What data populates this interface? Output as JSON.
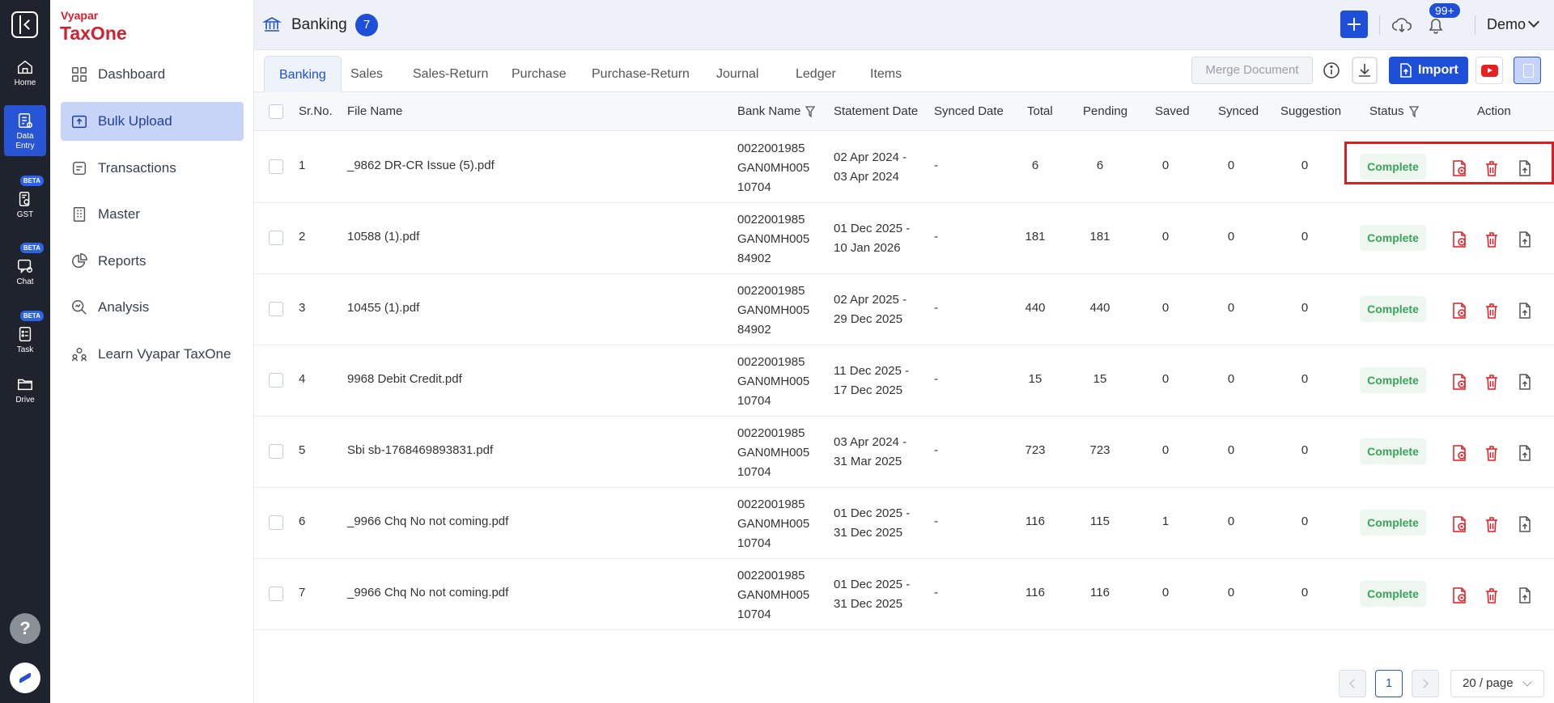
{
  "rail": {
    "items": [
      {
        "label": "Home"
      },
      {
        "label": "Data\nEntry"
      },
      {
        "label": "GST"
      },
      {
        "label": "Chat"
      },
      {
        "label": "Task"
      },
      {
        "label": "Drive"
      }
    ],
    "beta": "BETA",
    "help": "?"
  },
  "brand": {
    "top": "Vyapar",
    "main": "TaxOne"
  },
  "sidebar": {
    "items": [
      {
        "label": "Dashboard",
        "icon": "grid-icon"
      },
      {
        "label": "Bulk Upload",
        "icon": "upload-icon"
      },
      {
        "label": "Transactions",
        "icon": "transactions-icon"
      },
      {
        "label": "Master",
        "icon": "building-icon"
      },
      {
        "label": "Reports",
        "icon": "pie-chart-icon"
      },
      {
        "label": "Analysis",
        "icon": "magnifier-icon"
      },
      {
        "label": "Learn Vyapar TaxOne",
        "icon": "users-icon"
      }
    ]
  },
  "header": {
    "title": "Banking",
    "count": "7",
    "notifications": "99+",
    "user": "Demo"
  },
  "tabs": [
    "Banking",
    "Sales",
    "Sales-Return",
    "Purchase",
    "Purchase-Return",
    "Journal",
    "Ledger",
    "Items"
  ],
  "toolbar": {
    "merge": "Merge Document",
    "import": "Import"
  },
  "table": {
    "columns": [
      "Sr.No.",
      "File Name",
      "Bank Name",
      "Statement Date",
      "Synced Date",
      "Total",
      "Pending",
      "Saved",
      "Synced",
      "Suggestion",
      "Status",
      "Action"
    ],
    "rows": [
      {
        "sr": "1",
        "file": "_9862 DR-CR Issue (5).pdf",
        "bank": [
          "0022001985",
          "GAN0MH005",
          "10704"
        ],
        "stmt": [
          "02 Apr 2024 -",
          "03 Apr 2024"
        ],
        "synced_date": "-",
        "total": "6",
        "pending": "6",
        "saved": "0",
        "synced": "0",
        "suggestion": "0",
        "status": "Complete"
      },
      {
        "sr": "2",
        "file": "10588 (1).pdf",
        "bank": [
          "0022001985",
          "GAN0MH005",
          "84902"
        ],
        "stmt": [
          "01 Dec 2025 -",
          "10 Jan 2026"
        ],
        "synced_date": "-",
        "total": "181",
        "pending": "181",
        "saved": "0",
        "synced": "0",
        "suggestion": "0",
        "status": "Complete"
      },
      {
        "sr": "3",
        "file": "10455 (1).pdf",
        "bank": [
          "0022001985",
          "GAN0MH005",
          "84902"
        ],
        "stmt": [
          "02 Apr 2025 -",
          "29 Dec 2025"
        ],
        "synced_date": "-",
        "total": "440",
        "pending": "440",
        "saved": "0",
        "synced": "0",
        "suggestion": "0",
        "status": "Complete"
      },
      {
        "sr": "4",
        "file": "9968 Debit Credit.pdf",
        "bank": [
          "0022001985",
          "GAN0MH005",
          "10704"
        ],
        "stmt": [
          "11 Dec 2025 -",
          "17 Dec 2025"
        ],
        "synced_date": "-",
        "total": "15",
        "pending": "15",
        "saved": "0",
        "synced": "0",
        "suggestion": "0",
        "status": "Complete"
      },
      {
        "sr": "5",
        "file": "Sbi sb-1768469893831.pdf",
        "bank": [
          "0022001985",
          "GAN0MH005",
          "10704"
        ],
        "stmt": [
          "03 Apr 2024 -",
          "31 Mar 2025"
        ],
        "synced_date": "-",
        "total": "723",
        "pending": "723",
        "saved": "0",
        "synced": "0",
        "suggestion": "0",
        "status": "Complete"
      },
      {
        "sr": "6",
        "file": "_9966 Chq No not coming.pdf",
        "bank": [
          "0022001985",
          "GAN0MH005",
          "10704"
        ],
        "stmt": [
          "01 Dec 2025 -",
          "31 Dec 2025"
        ],
        "synced_date": "-",
        "total": "116",
        "pending": "115",
        "saved": "1",
        "synced": "0",
        "suggestion": "0",
        "status": "Complete"
      },
      {
        "sr": "7",
        "file": "_9966 Chq No not coming.pdf",
        "bank": [
          "0022001985",
          "GAN0MH005",
          "10704"
        ],
        "stmt": [
          "01 Dec 2025 -",
          "31 Dec 2025"
        ],
        "synced_date": "-",
        "total": "116",
        "pending": "116",
        "saved": "0",
        "synced": "0",
        "suggestion": "0",
        "status": "Complete"
      }
    ]
  },
  "pagination": {
    "current": "1",
    "page_size": "20 / page"
  },
  "colors": {
    "accent": "#1e4fd8",
    "brand": "#d51f2e",
    "status_complete": "#3aa55a",
    "danger": "#e01b24"
  }
}
